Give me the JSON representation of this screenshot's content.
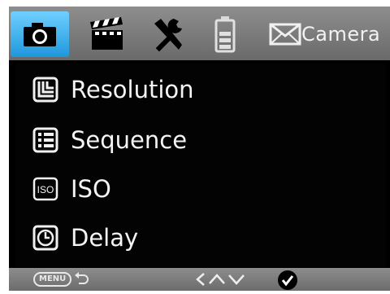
{
  "tabs": [
    {
      "icon": "camera-icon",
      "active": true
    },
    {
      "icon": "video-clapper-icon",
      "active": false
    },
    {
      "icon": "tools-icon",
      "active": false
    },
    {
      "icon": "battery-icon",
      "active": false
    },
    {
      "icon": "envelope-icon",
      "active": false
    }
  ],
  "tab_title": "Camera",
  "menu": {
    "items": [
      {
        "label": "Resolution",
        "icon": "resolution-icon"
      },
      {
        "label": "Sequence",
        "icon": "sequence-icon"
      },
      {
        "label": "ISO",
        "icon": "iso-icon"
      },
      {
        "label": "Delay",
        "icon": "delay-clock-icon"
      }
    ]
  },
  "footer": {
    "menu_label": "MENU",
    "back_icon": "back-arrow-icon",
    "nav_icons": [
      "arrow-left-icon",
      "arrow-up-icon",
      "arrow-down-icon"
    ],
    "ok_icon": "checkmark-icon"
  },
  "colors": {
    "active_tab": "#2aa6e8",
    "bar": "#7a7a7a",
    "screen": "#000000",
    "text": "#f4f4f4"
  }
}
